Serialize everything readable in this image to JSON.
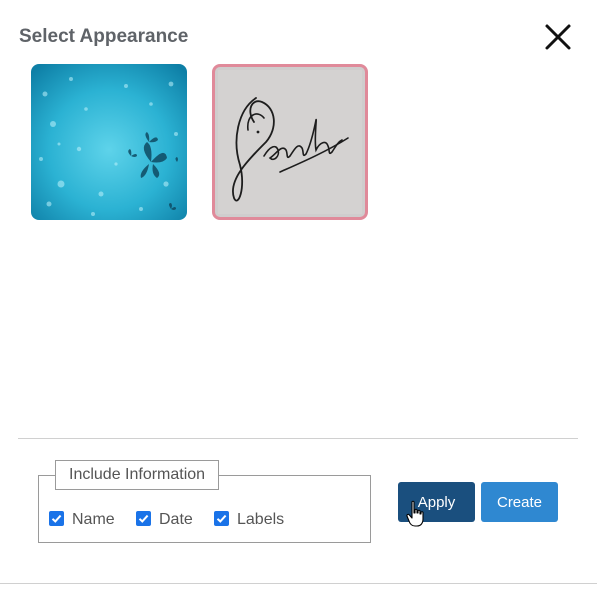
{
  "dialog": {
    "title": "Select Appearance",
    "close_icon": "close-icon"
  },
  "appearances": [
    {
      "name": "butterfly-background",
      "icon": "butterfly-image"
    },
    {
      "name": "signature-image",
      "icon": "signature-image",
      "selected": true
    }
  ],
  "include_information": {
    "legend": "Include Information",
    "options": [
      {
        "label": "Name",
        "checked": true
      },
      {
        "label": "Date",
        "checked": true
      },
      {
        "label": "Labels",
        "checked": true
      }
    ]
  },
  "buttons": {
    "apply": "Apply",
    "create": "Create"
  },
  "colors": {
    "title": "#5f6368",
    "apply_bg": "#1a4f7e",
    "create_bg": "#2f88d1",
    "checkbox": "#1a73e8",
    "selected_border": "#e08a9a"
  }
}
